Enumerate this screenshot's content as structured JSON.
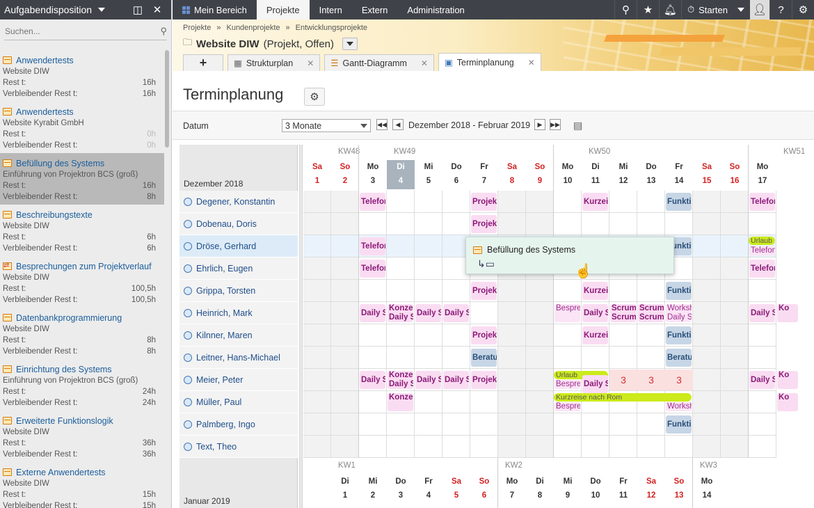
{
  "sidebar": {
    "title": "Aufgabendisposition",
    "search_placeholder": "Suchen...",
    "rest_label": "Rest t:",
    "verbl_label": "Verbleibender Rest t:",
    "tasks": [
      {
        "name": "Anwendertests",
        "project": "Website DIW",
        "rest": "16h",
        "verbl": "16h"
      },
      {
        "name": "Anwendertests",
        "project": "Website Kyrabit GmbH",
        "rest": "0h",
        "verbl": "0h"
      },
      {
        "name": "Befüllung des Systems",
        "project": "Einführung von Projektron BCS (groß)",
        "rest": "16h",
        "verbl": "8h"
      },
      {
        "name": "Beschreibungstexte",
        "project": "Website DIW",
        "rest": "6h",
        "verbl": "6h"
      },
      {
        "name": "Besprechungen zum Projektverlauf",
        "project": "Website DIW",
        "rest": "100,5h",
        "verbl": "100,5h"
      },
      {
        "name": "Datenbankprogrammierung",
        "project": "Website DIW",
        "rest": "8h",
        "verbl": "8h"
      },
      {
        "name": "Einrichtung des Systems",
        "project": "Einführung von Projektron BCS (groß)",
        "rest": "24h",
        "verbl": "24h"
      },
      {
        "name": "Erweiterte Funktionslogik",
        "project": "Website DIW",
        "rest": "36h",
        "verbl": "36h"
      },
      {
        "name": "Externe Anwendertests",
        "project": "Website DIW",
        "rest": "15h",
        "verbl": "15h"
      }
    ]
  },
  "nav": {
    "items": [
      "Mein Bereich",
      "Projekte",
      "Intern",
      "Extern",
      "Administration"
    ],
    "start_label": "Starten"
  },
  "header": {
    "breadcrumb": [
      "Projekte",
      "»",
      "Kundenprojekte",
      "»",
      "Entwicklungsprojekte"
    ],
    "project_name": "Website DIW",
    "project_status": "(Projekt, Offen)",
    "tabs": [
      "Strukturplan",
      "Gantt-Diagramm",
      "Terminplanung"
    ],
    "plus": "+"
  },
  "toolbar": {
    "title": "Terminplanung",
    "datum_label": "Datum",
    "period": "3 Monate",
    "range": "Dezember 2018 - Februar 2019"
  },
  "calendar": {
    "month1": "Dezember 2018",
    "month2": "Januar 2019",
    "kw_top": [
      "KW48",
      "KW49",
      "KW50",
      "KW51"
    ],
    "kw_bottom": [
      "KW1",
      "KW2",
      "KW3"
    ],
    "days_top": [
      [
        "Sa",
        "1"
      ],
      [
        "So",
        "2"
      ],
      [
        "Mo",
        "3"
      ],
      [
        "Di",
        "4"
      ],
      [
        "Mi",
        "5"
      ],
      [
        "Do",
        "6"
      ],
      [
        "Fr",
        "7"
      ],
      [
        "Sa",
        "8"
      ],
      [
        "So",
        "9"
      ],
      [
        "Mo",
        "10"
      ],
      [
        "Di",
        "11"
      ],
      [
        "Mi",
        "12"
      ],
      [
        "Do",
        "13"
      ],
      [
        "Fr",
        "14"
      ],
      [
        "Sa",
        "15"
      ],
      [
        "So",
        "16"
      ],
      [
        "Mo",
        "17"
      ]
    ],
    "days_bottom": [
      [
        "Di",
        "1"
      ],
      [
        "Mi",
        "2"
      ],
      [
        "Do",
        "3"
      ],
      [
        "Fr",
        "4"
      ],
      [
        "Sa",
        "5"
      ],
      [
        "So",
        "6"
      ],
      [
        "Mo",
        "7"
      ],
      [
        "Di",
        "8"
      ],
      [
        "Mi",
        "9"
      ],
      [
        "Do",
        "10"
      ],
      [
        "Fr",
        "11"
      ],
      [
        "Sa",
        "12"
      ],
      [
        "So",
        "13"
      ],
      [
        "Mo",
        "14"
      ]
    ],
    "people": [
      "Degener, Konstantin",
      "Dobenau, Doris",
      "Dröse, Gerhard",
      "Ehrlich, Eugen",
      "Grippa, Torsten",
      "Heinrich, Mark",
      "Kilnner, Maren",
      "Leitner, Hans-Michael",
      "Meier, Peter",
      "Müller, Paul",
      "Palmberg, Ingo",
      "Text, Theo"
    ],
    "events": {
      "telefon": "Telefon",
      "projekt": "Projekt",
      "kurzein": "Kurzein",
      "funktio": "Funktio",
      "daily": "Daily S",
      "konzep": "Konzep",
      "daily_s": "Daily S",
      "bespre": "Bespre",
      "scrum": "Scrum",
      "worksh": "Worksh",
      "beratu": "Beratu",
      "urlaub": "Urlaub",
      "kurzreise": "Kurzreise nach Rom",
      "three": "3",
      "ko": "Ko"
    }
  },
  "tooltip": {
    "title": "Befüllung des Systems"
  }
}
